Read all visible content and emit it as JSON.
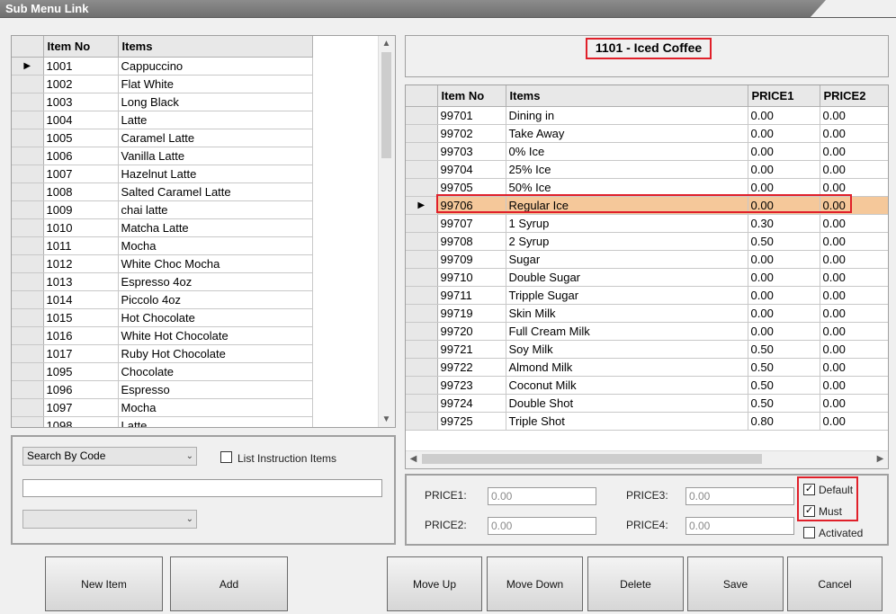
{
  "window": {
    "title": "Sub Menu Link"
  },
  "left_grid": {
    "headers": [
      "Item No",
      "Items"
    ],
    "rows": [
      [
        "1001",
        "Cappuccino"
      ],
      [
        "1002",
        "Flat White"
      ],
      [
        "1003",
        "Long Black"
      ],
      [
        "1004",
        "Latte"
      ],
      [
        "1005",
        "Caramel Latte"
      ],
      [
        "1006",
        "Vanilla Latte"
      ],
      [
        "1007",
        "Hazelnut Latte"
      ],
      [
        "1008",
        "Salted Caramel Latte"
      ],
      [
        "1009",
        "chai latte"
      ],
      [
        "1010",
        "Matcha Latte"
      ],
      [
        "1011",
        "Mocha"
      ],
      [
        "1012",
        "White Choc Mocha"
      ],
      [
        "1013",
        "Espresso 4oz"
      ],
      [
        "1014",
        "Piccolo 4oz"
      ],
      [
        "1015",
        "Hot Chocolate"
      ],
      [
        "1016",
        "White Hot Chocolate"
      ],
      [
        "1017",
        "Ruby Hot Chocolate"
      ],
      [
        "1095",
        "Chocolate"
      ],
      [
        "1096",
        "Espresso"
      ],
      [
        "1097",
        "Mocha"
      ],
      [
        "1098",
        "Latte"
      ]
    ],
    "current_row_index": 0
  },
  "selected_item": {
    "title": "1101 - Iced Coffee"
  },
  "right_grid": {
    "headers": [
      "Item No",
      "Items",
      "PRICE1",
      "PRICE2"
    ],
    "rows": [
      [
        "99701",
        "Dining in",
        "0.00",
        "0.00"
      ],
      [
        "99702",
        "Take Away",
        "0.00",
        "0.00"
      ],
      [
        "99703",
        "0% Ice",
        "0.00",
        "0.00"
      ],
      [
        "99704",
        "25% Ice",
        "0.00",
        "0.00"
      ],
      [
        "99705",
        "50% Ice",
        "0.00",
        "0.00"
      ],
      [
        "99706",
        "Regular Ice",
        "0.00",
        "0.00"
      ],
      [
        "99707",
        "1 Syrup",
        "0.30",
        "0.00"
      ],
      [
        "99708",
        "2 Syrup",
        "0.50",
        "0.00"
      ],
      [
        "99709",
        "Sugar",
        "0.00",
        "0.00"
      ],
      [
        "99710",
        "Double Sugar",
        "0.00",
        "0.00"
      ],
      [
        "99711",
        "Tripple Sugar",
        "0.00",
        "0.00"
      ],
      [
        "99719",
        "Skin Milk",
        "0.00",
        "0.00"
      ],
      [
        "99720",
        "Full Cream Milk",
        "0.00",
        "0.00"
      ],
      [
        "99721",
        "Soy Milk",
        "0.50",
        "0.00"
      ],
      [
        "99722",
        "Almond Milk",
        "0.50",
        "0.00"
      ],
      [
        "99723",
        "Coconut Milk",
        "0.50",
        "0.00"
      ],
      [
        "99724",
        "Double Shot",
        "0.50",
        "0.00"
      ],
      [
        "99725",
        "Triple Shot",
        "0.80",
        "0.00"
      ]
    ],
    "selected_row_index": 5,
    "selected_row_color": "#f5c89a"
  },
  "search": {
    "mode_label": "Search By Code",
    "list_instruction_label": "List Instruction Items",
    "list_instruction_checked": false,
    "text_value": "",
    "second_combo_value": ""
  },
  "price_panel": {
    "price1_label": "PRICE1:",
    "price1_value": "0.00",
    "price2_label": "PRICE2:",
    "price2_value": "0.00",
    "price3_label": "PRICE3:",
    "price3_value": "0.00",
    "price4_label": "PRICE4:",
    "price4_value": "0.00",
    "default_label": "Default",
    "default_checked": true,
    "must_label": "Must",
    "must_checked": true,
    "activated_label": "Activated",
    "activated_checked": false
  },
  "buttons": {
    "new_item": "New Item",
    "add": "Add",
    "move_up": "Move Up",
    "move_down": "Move Down",
    "delete": "Delete",
    "save": "Save",
    "cancel": "Cancel"
  },
  "colors": {
    "highlight_border": "#e0202a",
    "title_bar": "#7a7a7a"
  }
}
